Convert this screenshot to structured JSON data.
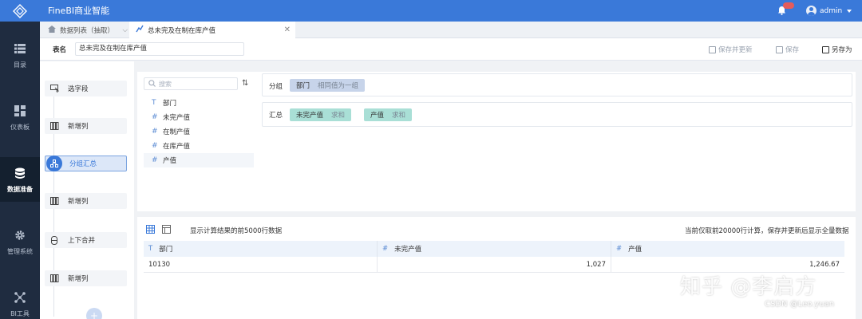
{
  "app": {
    "title": "FineBI商业智能",
    "user": "admin"
  },
  "nav": [
    {
      "label": "目录",
      "icon": "list-icon"
    },
    {
      "label": "仪表板",
      "icon": "dashboard-icon"
    },
    {
      "label": "数据准备",
      "icon": "database-icon",
      "active": true
    },
    {
      "label": "管理系统",
      "icon": "gear-icon"
    },
    {
      "label": "BI工具",
      "icon": "network-icon"
    }
  ],
  "tabs": [
    {
      "label": "数据列表（抽取）",
      "icon": "home-icon"
    },
    {
      "label": "总未完及在制在库产值",
      "icon": "dataset-icon",
      "active": true
    }
  ],
  "table_name": {
    "label": "表名",
    "value": "总未完及在制在库产值"
  },
  "actions": {
    "save_update": "保存并更新",
    "save": "保存",
    "save_as": "另存为"
  },
  "steps": [
    {
      "label": "选字段",
      "icon": "select-field-icon"
    },
    {
      "label": "新增列",
      "icon": "add-column-icon"
    },
    {
      "label": "分组汇总",
      "icon": "group-summary-icon",
      "active": true
    },
    {
      "label": "新增列",
      "icon": "add-column-icon"
    },
    {
      "label": "上下合并",
      "icon": "merge-icon"
    },
    {
      "label": "新增列",
      "icon": "add-column-icon"
    }
  ],
  "search": {
    "placeholder": "搜索"
  },
  "fields": [
    {
      "type": "T",
      "name": "部门"
    },
    {
      "type": "#",
      "name": "未完产值"
    },
    {
      "type": "#",
      "name": "在制产值"
    },
    {
      "type": "#",
      "name": "在库产值"
    },
    {
      "type": "#",
      "name": "产值"
    }
  ],
  "group": {
    "label": "分组",
    "items": [
      {
        "name": "部门",
        "method": "相同值为一组"
      }
    ]
  },
  "summary": {
    "label": "汇总",
    "items": [
      {
        "name": "未完产值",
        "method": "求和"
      },
      {
        "name": "产值",
        "method": "求和"
      }
    ]
  },
  "preview": {
    "note": "显示计算结果的前5000行数据",
    "right_note": "当前仅取前20000行计算，保存并更新后显示全量数据",
    "columns": [
      {
        "type": "T",
        "name": "部门"
      },
      {
        "type": "#",
        "name": "未完产值"
      },
      {
        "type": "#",
        "name": "产值"
      }
    ],
    "rows": [
      [
        "10130",
        "1,027",
        "1,246.67"
      ]
    ]
  },
  "watermark": "知乎 @李启方",
  "credit": "CSDN @Leo.yuan",
  "colors": {
    "topbar": "#3a79d9",
    "sidebar": "#1f2c40",
    "dim_pill": "#c7d4ea",
    "value_pill": "#a9dfd6"
  }
}
